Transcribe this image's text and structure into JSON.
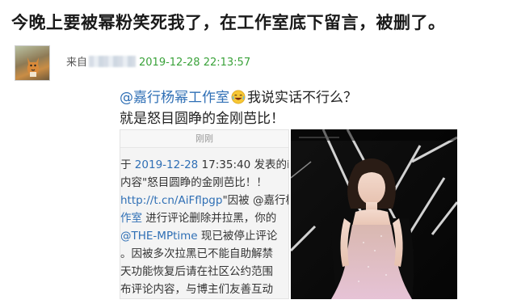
{
  "post": {
    "headline": "今晚上要被幂粉笑死我了，在工作室底下留言，被删了。",
    "source_label": "来自",
    "timestamp": "2019-12-28 22:13:57"
  },
  "comment": {
    "mention": "@嘉行杨幂工作室",
    "emoji": "laughing-tears-emoji",
    "line1_text": "我说实话不行么？",
    "line2_text": "就是怒目圆睁的金刚芭比！"
  },
  "notice": {
    "header": "刚刚",
    "lines": [
      {
        "plain_a": "于 ",
        "link": "2019-12-28",
        "plain_b": " 17:35:40 发表的i"
      },
      {
        "plain_a": "内容\"怒目圆睁的金刚芭比！！",
        "link": "",
        "plain_b": ""
      },
      {
        "plain_a": "",
        "link": "http://t.cn/AiFflpgp",
        "plain_b": "\"因被 @嘉行杨"
      },
      {
        "plain_a": "",
        "link": "作室",
        "plain_b": " 进行评论删除并拉黑，你的"
      },
      {
        "plain_a": "",
        "link": "@THE-MPtime",
        "plain_b": " 现已被停止评论"
      },
      {
        "plain_a": "。因被多次拉黑已不能自助解禁",
        "link": "",
        "plain_b": ""
      },
      {
        "plain_a": "天功能恢复后请在社区公约范围",
        "link": "",
        "plain_b": ""
      },
      {
        "plain_a": "布评论内容，与博主们友善互动",
        "link": "",
        "plain_b": ""
      }
    ]
  },
  "colors": {
    "mention": "#2f6fb5",
    "timestamp": "#3aa23a"
  }
}
